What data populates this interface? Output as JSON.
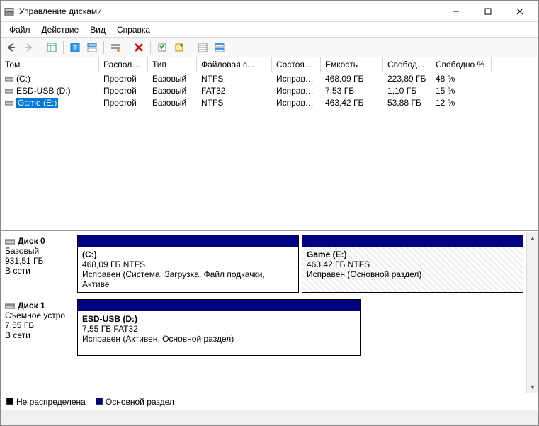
{
  "window": {
    "title": "Управление дисками"
  },
  "menu": {
    "file": "Файл",
    "action": "Действие",
    "view": "Вид",
    "help": "Справка"
  },
  "columns": [
    "Том",
    "Располо...",
    "Тип",
    "Файловая с...",
    "Состояние",
    "Емкость",
    "Свобод...",
    "Свободно %"
  ],
  "volumes": [
    {
      "name": "(C:)",
      "layout": "Простой",
      "type": "Базовый",
      "fs": "NTFS",
      "status": "Исправен...",
      "capacity": "468,09 ГБ",
      "free": "223,89 ГБ",
      "freepct": "48 %",
      "selected": false
    },
    {
      "name": "ESD-USB (D:)",
      "layout": "Простой",
      "type": "Базовый",
      "fs": "FAT32",
      "status": "Исправен...",
      "capacity": "7,53 ГБ",
      "free": "1,10 ГБ",
      "freepct": "15 %",
      "selected": false
    },
    {
      "name": "Game (E:)",
      "layout": "Простой",
      "type": "Базовый",
      "fs": "NTFS",
      "status": "Исправен...",
      "capacity": "463,42 ГБ",
      "free": "53,88 ГБ",
      "freepct": "12 %",
      "selected": true
    }
  ],
  "disks": [
    {
      "name": "Диск 0",
      "type": "Базовый",
      "size": "931,51 ГБ",
      "status": "В сети",
      "parts": [
        {
          "name": "(C:)",
          "info": "468,09 ГБ NTFS",
          "status": "Исправен (Система, Загрузка, Файл подкачки, Активе",
          "flex": "1",
          "hatched": false
        },
        {
          "name": "Game  (E:)",
          "info": "463,42 ГБ NTFS",
          "status": "Исправен (Основной раздел)",
          "flex": "1",
          "hatched": true
        }
      ]
    },
    {
      "name": "Диск 1",
      "type": "Съемное устро",
      "size": "7,55 ГБ",
      "status": "В сети",
      "parts": [
        {
          "name": "ESD-USB  (D:)",
          "info": "7,55 ГБ FAT32",
          "status": "Исправен (Активен, Основной раздел)",
          "flex": "0 0 400px",
          "hatched": false
        }
      ]
    }
  ],
  "legend": {
    "unallocated": "Не распределена",
    "primary": "Основной раздел"
  }
}
